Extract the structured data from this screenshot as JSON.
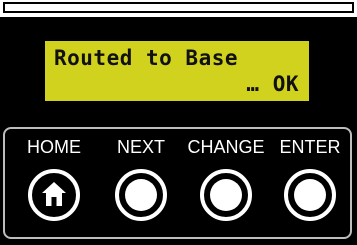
{
  "display": {
    "line1": "Routed to Base",
    "line2": "… OK"
  },
  "buttons": [
    {
      "label": "HOME",
      "icon": "home-icon"
    },
    {
      "label": "NEXT",
      "icon": "circle-button-icon"
    },
    {
      "label": "CHANGE",
      "icon": "circle-button-icon"
    },
    {
      "label": "ENTER",
      "icon": "circle-button-icon"
    }
  ],
  "colors": {
    "lcd_background": "#d1d21d",
    "panel": "#000000",
    "button": "#ffffff",
    "bay_border": "#bdbdbd"
  }
}
